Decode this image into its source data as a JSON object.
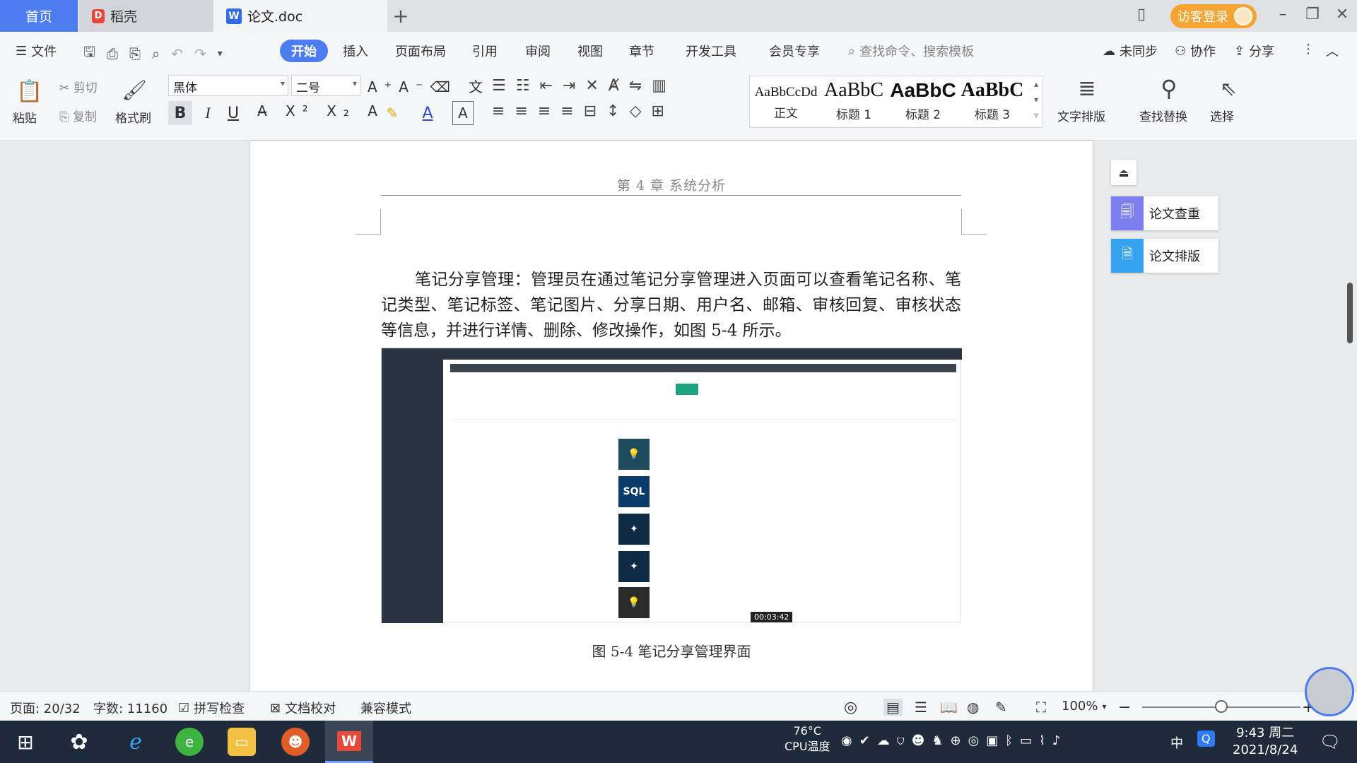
{
  "tabs": {
    "home": "首页",
    "daoke": "稻壳",
    "doc": "论文.doc",
    "new_tab": "+"
  },
  "titlebar": {
    "login": "访客登录"
  },
  "menu": {
    "file": "文件",
    "items": [
      "开始",
      "插入",
      "页面布局",
      "引用",
      "审阅",
      "视图",
      "章节",
      "开发工具",
      "会员专享"
    ],
    "search_placeholder": "查找命令、搜索模板",
    "unsync": "未同步",
    "collab": "协作",
    "share": "分享"
  },
  "ribbon": {
    "paste": "粘贴",
    "cut": "剪切",
    "copy": "复制",
    "format_painter": "格式刷",
    "font_name": "黑体",
    "font_size": "二号",
    "styles": [
      {
        "sample": "AaBbCcDd",
        "name": "正文"
      },
      {
        "sample": "AaBbC",
        "name": "标题 1"
      },
      {
        "sample": "AaBbC",
        "name": "标题 2"
      },
      {
        "sample": "AaBbC",
        "name": "标题 3"
      }
    ],
    "text_layout": "文字排版",
    "find_replace": "查找替换",
    "select": "选择"
  },
  "document": {
    "header": "第 4 章  系统分析",
    "paragraph": "笔记分享管理：管理员在通过笔记分享管理进入页面可以查看笔记名称、笔记类型、笔记标签、笔记图片、分享日期、用户名、邮箱、审核回复、审核状态等信息，并进行详情、删除、修改操作，如图 5-4 所示。",
    "figure_thumb_label": "SQL",
    "caption": "图 5-4 笔记分享管理界面",
    "video_time": "00:03:42"
  },
  "side_panel": {
    "check": "论文查重",
    "layout": "论文排版"
  },
  "status": {
    "page": "页面: 20/32",
    "words": "字数: 11160",
    "spell": "拼写检查",
    "proof": "文档校对",
    "compat": "兼容模式",
    "zoom": "100%",
    "zoom_level": 0.5
  },
  "taskbar": {
    "cpu_temp": "76°C",
    "cpu_label": "CPU温度",
    "ime": "中",
    "time": "9:43 周二",
    "date": "2021/8/24"
  },
  "colors": {
    "accent": "#4d7cf1",
    "login": "#f7a532",
    "taskbar": "#1f2a3a"
  }
}
